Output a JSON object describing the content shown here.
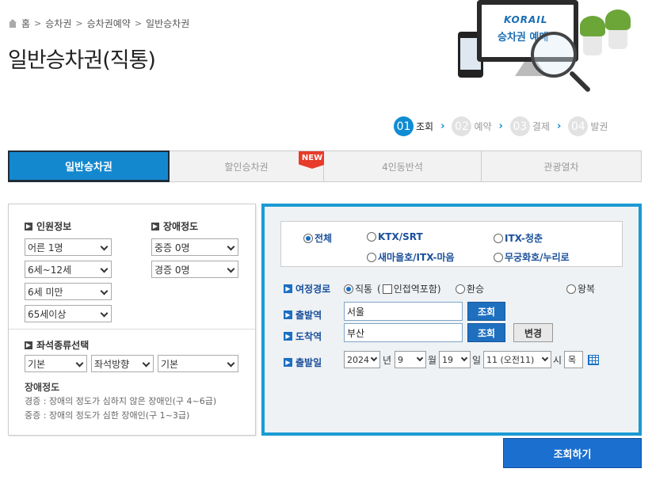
{
  "breadcrumb": [
    "홈",
    "승차권",
    "승차권예약",
    "일반승차권"
  ],
  "page_title": "일반승차권(직통)",
  "banner": {
    "logo": "KORAIL",
    "text": "승차권 예매"
  },
  "steps": [
    {
      "num": "01",
      "label": "조회",
      "active": true
    },
    {
      "num": "02",
      "label": "예약",
      "active": false
    },
    {
      "num": "03",
      "label": "결제",
      "active": false
    },
    {
      "num": "04",
      "label": "발권",
      "active": false
    }
  ],
  "tabs": [
    {
      "label": "일반승차권",
      "active": true
    },
    {
      "label": "할인승차권",
      "badge": "NEW"
    },
    {
      "label": "4인동반석"
    },
    {
      "label": "관광열차"
    }
  ],
  "passengers": {
    "heading": "인원정보",
    "adult": "어른 1명",
    "child": "6세~12세",
    "infant": "6세 미만",
    "senior": "65세이상"
  },
  "disability": {
    "heading": "장애정도",
    "severe": "중증 0명",
    "mild": "경증 0명"
  },
  "seat_type": {
    "heading": "좌석종류선택",
    "type": "기본",
    "direction": "좌석방향",
    "position": "기본"
  },
  "note": {
    "title": "장애정도",
    "mild": "경증 : 장애의 정도가 심하지 않은 장애인(구 4~6급)",
    "severe": "중증 : 장애의 정도가 심한 장애인(구 1~3급)"
  },
  "train_types": {
    "all": "전체",
    "ktx_srt": "KTX/SRT",
    "itx_cheongchun": "ITX-청춘",
    "saemaeul": "새마을호/ITX-마음",
    "mugunghwa": "무궁화호/누리로"
  },
  "route": {
    "label": "여정경로",
    "direct": "직통",
    "nearby_pre": "(",
    "nearby": "인접역포함)",
    "transfer": "환승",
    "round_trip": "왕복"
  },
  "departure": {
    "label": "출발역",
    "value": "서울",
    "search_btn": "조회"
  },
  "arrival": {
    "label": "도착역",
    "value": "부산",
    "search_btn": "조회",
    "swap_btn": "변경"
  },
  "date": {
    "label": "출발일",
    "year": "2024",
    "year_unit": "년",
    "month": "9",
    "month_unit": "월",
    "day": "19",
    "day_unit": "일",
    "hour": "11 (오전11)",
    "hour_unit": "시",
    "weekday": "목"
  },
  "submit": "조회하기",
  "colors": {
    "accent": "#1488cf",
    "panel_border": "#1b9ad3",
    "button": "#1b6fcf",
    "badge": "#e73c2b"
  }
}
